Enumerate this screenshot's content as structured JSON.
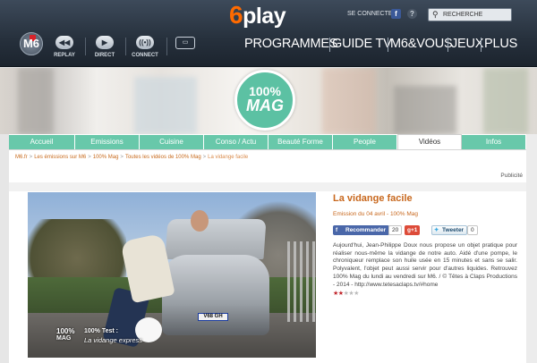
{
  "header": {
    "brand_six": "6",
    "brand_play": "play",
    "login_label": "SE CONNECTER",
    "fb_icon": "f",
    "help_icon": "?",
    "search_placeholder": "RECHERCHE",
    "channel_logo": "M6",
    "nav": [
      {
        "label": "REPLAY",
        "icon": "rewind-icon",
        "glyph": "◀◀"
      },
      {
        "label": "DIRECT",
        "icon": "play-icon",
        "glyph": "▶"
      },
      {
        "label": "CONNECT",
        "icon": "connect-icon",
        "glyph": "((•))"
      }
    ],
    "tv_icon_glyph": "▭",
    "main_menu": [
      "PROGRAMMES",
      "GUIDE TV",
      "M6&VOUS",
      "JEUX",
      "PLUS"
    ]
  },
  "banner": {
    "show_logo_top": "100%",
    "show_logo_bottom": "MAG"
  },
  "tabs": [
    "Accueil",
    "Emissions",
    "Cuisine",
    "Conso / Actu",
    "Beauté Forme",
    "People",
    "Vidéos",
    "Infos"
  ],
  "active_tab": "Vidéos",
  "breadcrumb": [
    "M6.fr",
    "Les émissions sur M6",
    "100% Mag",
    "Toutes les vidéos de 100% Mag",
    "La vidange facile"
  ],
  "breadcrumb_sep": ">",
  "pub_label": "Publicité",
  "video": {
    "plate": "V68 GH",
    "overlay_logo_top": "100%",
    "overlay_logo_bottom": "MAG",
    "overlay_line1": "100% Test :",
    "overlay_line2": "La vidange express"
  },
  "article": {
    "title": "La vidange facile",
    "meta": "Emission du 04 avril - 100% Mag",
    "fb_label": "Recommander",
    "fb_count": "20",
    "gplus_label": "g+1",
    "tweet_label": "Tweeter",
    "tweet_count": "0",
    "description": "Aujourd'hui, Jean-Philippe Doux nous propose un objet pratique pour réaliser nous-même la vidange de notre auto. Aidé d'une pompe, le chroniqueur remplace son huile usée en 15 minutes et sans se salir. Polyvalent, l'objet peut aussi servir pour d'autres liquides. Retrouvez 100% Mag du lundi au vendredi sur M6. / © Têtes à Claps Productions - 2014 - http://www.tetesaclaps.tv/#home",
    "rating": {
      "value": 2,
      "max": 5
    },
    "star_glyph": "★"
  },
  "colors": {
    "accent_green": "#68c8aa",
    "accent_orange": "#c8681e",
    "brand_orange": "#ff6a00"
  }
}
